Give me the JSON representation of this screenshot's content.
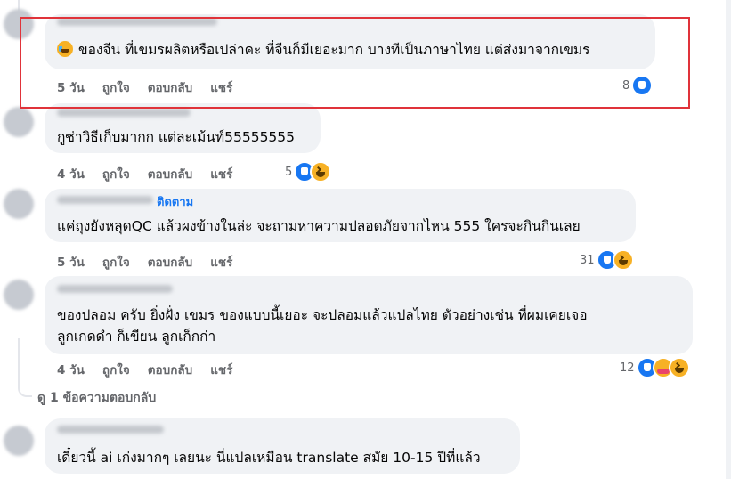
{
  "comments": [
    {
      "text_lines": [
        "ของจีน ที่เขมรผลิตหรือเปล่าคะ ที่จีนก็มีเยอะมาก บางทีเป็นภาษาไทย แต่ส่งมาจากเขมร"
      ],
      "has_emoji": true,
      "emoji": "grinning-sweat-emoji",
      "time": "5 วัน",
      "like_label": "ถูกใจ",
      "reply_label": "ตอบกลับ",
      "share_label": "แชร์",
      "reaction_count": "8",
      "reactions": [
        "like"
      ]
    },
    {
      "text_lines": [
        "กูซ่าวิธีเก็บมากก แต่ละเม้นท์55555555"
      ],
      "time": "4 วัน",
      "like_label": "ถูกใจ",
      "reply_label": "ตอบกลับ",
      "share_label": "แชร์",
      "reaction_count": "5",
      "reactions": [
        "like",
        "haha"
      ]
    },
    {
      "follow_label": "ติดตาม",
      "text_lines": [
        "แค่ถุงยังหลุดQC แล้วผงข้างในล่ะ จะถามหาความปลอดภัยจากไหน 555 ใครจะกินกินเลย"
      ],
      "time": "5 วัน",
      "like_label": "ถูกใจ",
      "reply_label": "ตอบกลับ",
      "share_label": "แชร์",
      "reaction_count": "31",
      "reactions": [
        "like",
        "haha"
      ]
    },
    {
      "text_lines": [
        "ของปลอม ครับ ยิ่งฝั่ง เขมร ของแบบนี้เยอะ จะปลอมแล้วแปลไทย ตัวอย่างเช่น ที่ผมเคยเจอ",
        "ลูกเกดดำ ก็เขียน ลูกเก็กก่า"
      ],
      "time": "4 วัน",
      "like_label": "ถูกใจ",
      "reply_label": "ตอบกลับ",
      "share_label": "แชร์",
      "reaction_count": "12",
      "reactions": [
        "like",
        "care",
        "haha"
      ]
    },
    {
      "text_lines": [
        "เดี๋ยวนี้ ai เก่งมากๆ เลยนะ นี่แปลเหมือน translate สมัย 10-15 ปีที่แล้ว"
      ]
    }
  ],
  "see_replies_label": "ดู 1 ข้อความตอบกลับ",
  "colors": {
    "highlight_border": "#e0333a",
    "bubble_bg": "#f0f2f5",
    "meta_text": "#65676b",
    "accent": "#1877f2"
  }
}
